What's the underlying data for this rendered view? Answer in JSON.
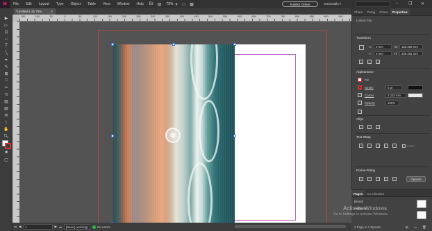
{
  "app": {
    "logo": "Id"
  },
  "menu": [
    "File",
    "Edit",
    "Layout",
    "Type",
    "Object",
    "Table",
    "View",
    "Window",
    "Help"
  ],
  "menu_icons": [
    "bridge-icon",
    "view-options-icon",
    "zoom-dropdown-icon"
  ],
  "zoom": "75%",
  "publish_label": "Publish Online",
  "workspace": "Essentials",
  "window_controls": {
    "minimize": "–",
    "restore": "❐",
    "close": "✕"
  },
  "document_tab": {
    "title": "*Untitled-1 @ 75%",
    "close": "×"
  },
  "ruler_ticks": [
    "150",
    "100",
    "50",
    "0",
    "50",
    "100",
    "150",
    "200",
    "250",
    "300",
    "350",
    "400",
    "450",
    "500",
    "550",
    "600",
    "650",
    "700",
    "750",
    "800",
    "850",
    "900",
    "950"
  ],
  "tools": [
    "selection",
    "direct-selection",
    "page",
    "gap",
    "type",
    "line",
    "pen",
    "pencil",
    "rectangle-frame",
    "rectangle",
    "scissors",
    "free-transform",
    "gradient-swatch",
    "gradient-feather",
    "note",
    "eyedropper",
    "hand",
    "zoom"
  ],
  "statusbar": {
    "page_number": "1",
    "style": "[Basic] (working)",
    "errors": "No errors"
  },
  "panel": {
    "tabs": [
      "Chara",
      "Parag",
      "Chara",
      "Properties"
    ],
    "object_type": "Linked File",
    "transform": {
      "heading": "Transform",
      "x_label": "X:",
      "x_value": "0 mm",
      "y_label": "Y:",
      "y_value": "0 mm",
      "w_label": "W:",
      "w_value": "136.358 mm",
      "h_label": "H:",
      "h_value": "205.481 mm"
    },
    "appearance": {
      "heading": "Appearance",
      "fill_label": "Fill",
      "stroke_label": "Stroke",
      "stroke_value": "0 pt",
      "corner_label": "Corner",
      "corner_value": "4.233 mm",
      "opacity_label": "Opacity",
      "opacity_value": "100%"
    },
    "align": {
      "heading": "Align"
    },
    "text_wrap": {
      "heading": "Text Wrap",
      "invert_label": "Invert"
    },
    "frame_fitting": {
      "heading": "Frame Fitting",
      "options_label": "Options"
    }
  },
  "pages_panel": {
    "tabs": [
      "Pages",
      "CC Libraries"
    ],
    "none_label": "[None]",
    "master_label": "A-Master",
    "footer": "1 Page in 1 Spread"
  },
  "watermark": {
    "title": "Activate Windows",
    "subtitle": "Go to Settings to activate Windows."
  },
  "colors": {
    "accent": "#3a7ad9",
    "bleed": "#b04a4a",
    "margin": "#c066c8",
    "status_ok": "#2db84c"
  }
}
